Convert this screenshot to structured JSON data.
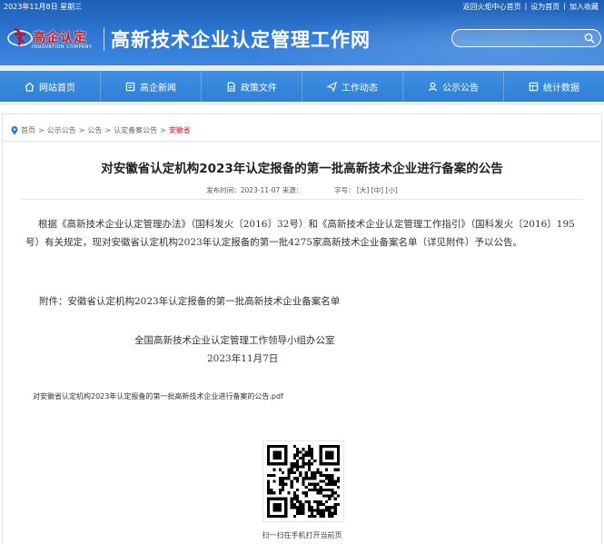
{
  "topbar": {
    "date": "2023年11月8日 星期三",
    "links": [
      "返回火炬中心首页",
      "设为首页",
      "加入收藏"
    ],
    "separator": "|"
  },
  "logo": {
    "cn": "高企认定",
    "en": "INNOVATION COMPANY"
  },
  "site_title": "高新技术企业认定管理工作网",
  "search": {
    "placeholder": ""
  },
  "nav": [
    {
      "label": "网站首页",
      "icon": "home-icon"
    },
    {
      "label": "高企新闻",
      "icon": "news-icon"
    },
    {
      "label": "政策文件",
      "icon": "document-icon"
    },
    {
      "label": "工作动态",
      "icon": "paper-plane-icon"
    },
    {
      "label": "公示公告",
      "icon": "user-icon"
    },
    {
      "label": "统计数据",
      "icon": "data-icon"
    }
  ],
  "breadcrumb": {
    "items": [
      "首页",
      "公示公告",
      "公告",
      "认定备案公告",
      "安徽省"
    ],
    "separator": ">"
  },
  "article": {
    "title": "对安徽省认定机构2023年认定报备的第一批高新技术企业进行备案的公告",
    "meta_published": "发布时间：2023-11-07 来源：",
    "meta_fontsize_label": "字号：",
    "meta_size_large": "[大]",
    "meta_size_medium": "[中]",
    "meta_size_small": "[小]",
    "body": "根据《高新技术企业认定管理办法》（国科发火〔2016〕32号）和《高新技术企业认定管理工作指引》（国科发火〔2016〕195号）有关规定，现对安徽省认定机构2023年认定报备的第一批4275家高新技术企业备案名单（详见附件）予以公告。",
    "attachment": "附件：安徽省认定机构2023年认定报备的第一批高新技术企业备案名单",
    "org": "全国高新技术企业认定管理工作领导小组办公室",
    "date": "2023年11月7日",
    "pdf_link": "对安徽省认定机构2023年认定报备的第一批高新技术企业进行备案的公告.pdf"
  },
  "qr_caption": "扫一扫在手机打开当前页",
  "colors": {
    "header_blue": "#2f7ad6",
    "nav_blue": "#3a8ae0",
    "accent_red": "#c8101c"
  }
}
